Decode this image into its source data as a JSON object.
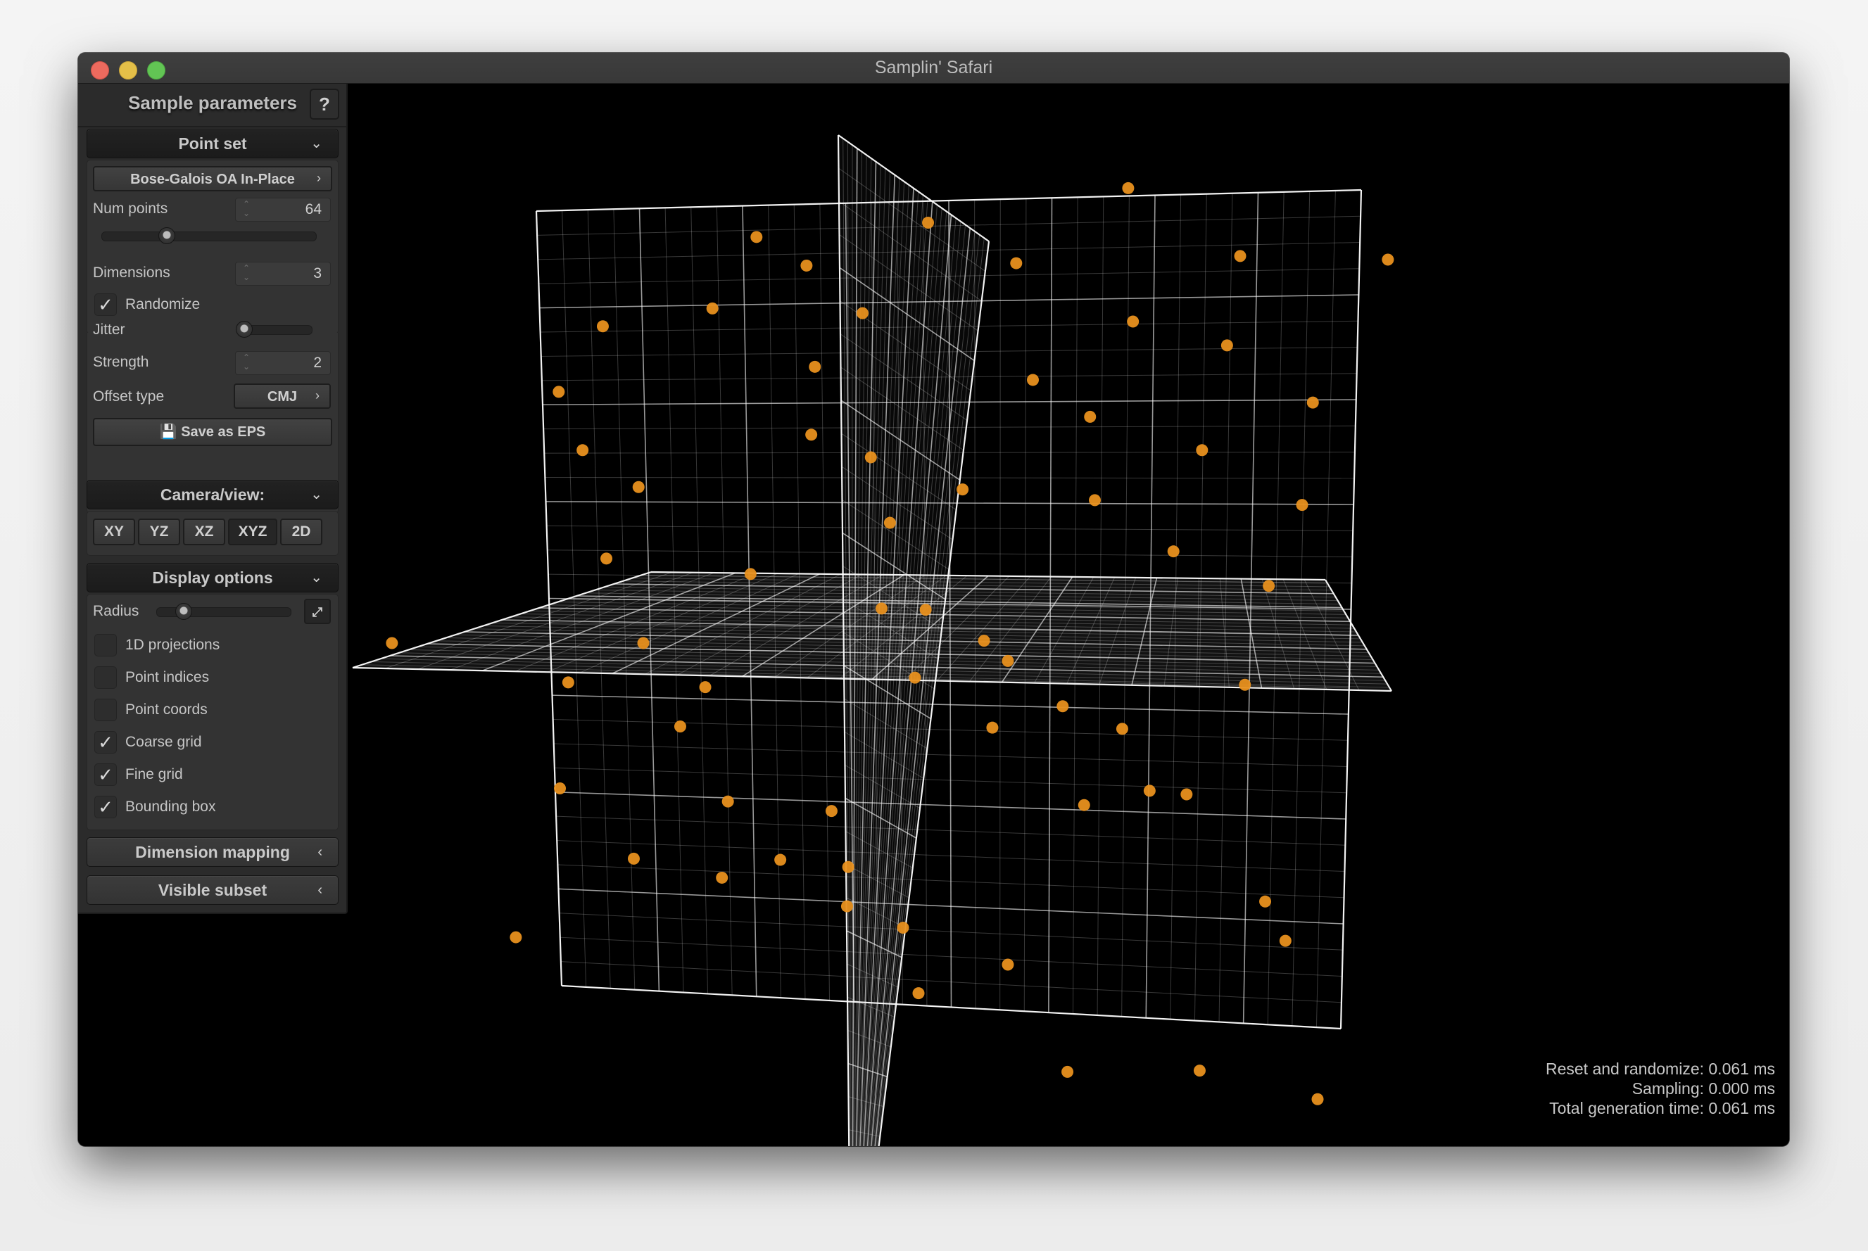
{
  "window": {
    "title": "Samplin' Safari"
  },
  "panel": {
    "title": "Sample parameters",
    "help_label": "?",
    "point_set": {
      "header": "Point set",
      "sampler": "Bose-Galois OA In-Place",
      "num_points_label": "Num points",
      "num_points": "64",
      "num_points_slider_fraction": 0.3,
      "dimensions_label": "Dimensions",
      "dimensions": "3",
      "randomize_label": "Randomize",
      "randomize_checked": true,
      "jitter_label": "Jitter",
      "jitter_fraction": 0.0,
      "strength_label": "Strength",
      "strength": "2",
      "offset_type_label": "Offset type",
      "offset_type": "CMJ",
      "save_label": "Save as EPS"
    },
    "camera": {
      "header": "Camera/view:",
      "views": [
        "XY",
        "YZ",
        "XZ",
        "XYZ",
        "2D"
      ],
      "active_view": "XYZ"
    },
    "display": {
      "header": "Display options",
      "radius_label": "Radius",
      "radius_fraction": 0.15,
      "options": [
        {
          "label": "1D projections",
          "checked": false
        },
        {
          "label": "Point indices",
          "checked": false
        },
        {
          "label": "Point coords",
          "checked": false
        },
        {
          "label": "Coarse grid",
          "checked": true
        },
        {
          "label": "Fine grid",
          "checked": true
        },
        {
          "label": "Bounding box",
          "checked": true
        }
      ]
    },
    "dimension_mapping": {
      "header": "Dimension mapping"
    },
    "visible_subset": {
      "header": "Visible subset"
    }
  },
  "stats": {
    "reset": "Reset and randomize: 0.061 ms",
    "sampling": "Sampling: 0.000 ms",
    "total": "Total generation time: 0.061 ms"
  },
  "scene": {
    "point_count": 64,
    "point_color": "#e8901e",
    "grid_color": "#ffffff",
    "background": "#000000",
    "coarse_divisions": 8,
    "fine_per_coarse": 4
  }
}
